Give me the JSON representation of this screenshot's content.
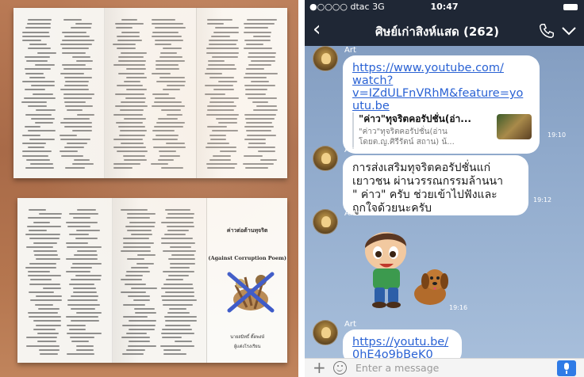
{
  "photo": {
    "brochure_title": "ค่าวต่อต้านทุจริต",
    "brochure_subtitle": "(Against Corruption Poem)",
    "brochure_author": "นายสมิทธิ์ ติ๊ดพงษ์",
    "brochure_school": "ผู้แต่งโรงเรียน"
  },
  "status": {
    "carrier": "●○○○○ dtac  3G",
    "time": "10:47"
  },
  "chat": {
    "title": "ศิษย์เก่าสิงห์แสด (262)",
    "back_icon": "chevron-left-icon",
    "call_icon": "phone-icon",
    "menu_icon": "chevron-down-icon"
  },
  "messages": [
    {
      "sender": "Art",
      "url_lines": [
        "https://www.youtube.com/",
        "watch?",
        "v=IZdULFnVRhM&feature=yo",
        "utu.be"
      ],
      "preview_title": "\"ค่าว\"ทุจริตคอรัปชั่น(อ่า...",
      "preview_desc": "\"ค่าว\"ทุจริตคอรัปชั่น(อ่าน โดยต.ญ.ศิรีรัตน์ สถาน) น้...",
      "time": "19:10"
    },
    {
      "sender": "Art",
      "text": "การส่งเสริมทุจริตคอรัปชั่นแก่เยาวชน ผ่านวรรณกรรมล้านนา \" ค่าว\" ครับ ช่วยเข้าไปฟังและถูกใจด้วยนะครับ",
      "text_lines": [
        "การส่งเสริมทุจริตคอรัปชั่นแก่",
        "เยาวชน ผ่านวรรณกรรมล้านนา",
        "\" ค่าว\" ครับ ช่วยเข้าไปฟังและ",
        "ถูกใจด้วยนะครับ"
      ],
      "time": "19:12"
    },
    {
      "sender": "Art",
      "sticker": "cartoon-boy-with-dog-sticker",
      "time": "19:16"
    },
    {
      "sender": "Art",
      "url_lines": [
        "https://youtu.be/",
        "0hE4o9bBeK0"
      ]
    }
  ],
  "input": {
    "placeholder": "Enter a message"
  }
}
